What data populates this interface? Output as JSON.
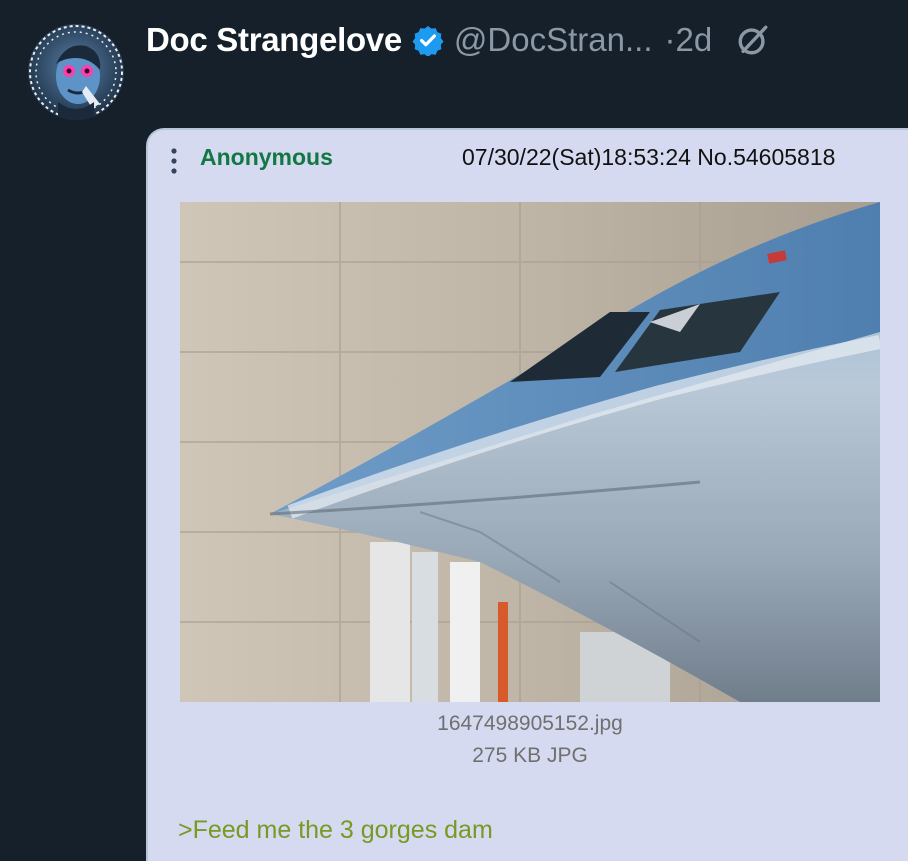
{
  "tweet": {
    "display_name": "Doc Strangelove",
    "handle": "@DocStran...",
    "time": "·2d",
    "icons": {
      "avatar": "avatar-image",
      "verified": "verified-badge-icon",
      "grok": "grok-icon"
    },
    "colors": {
      "background": "#15202b",
      "verified": "#1d9bf0",
      "secondary_text": "#8b98a5"
    }
  },
  "post": {
    "poster_name": "Anonymous",
    "meta": "07/30/22(Sat)18:53:24 No.54605818",
    "file_name": "1647498905152.jpg",
    "file_info": "275 KB JPG",
    "text": ">Feed me the 3 gorges dam",
    "image": "stealth-bomber-photo",
    "colors": {
      "background": "#d6daf0",
      "name": "#117743",
      "greentext": "#789922"
    }
  }
}
